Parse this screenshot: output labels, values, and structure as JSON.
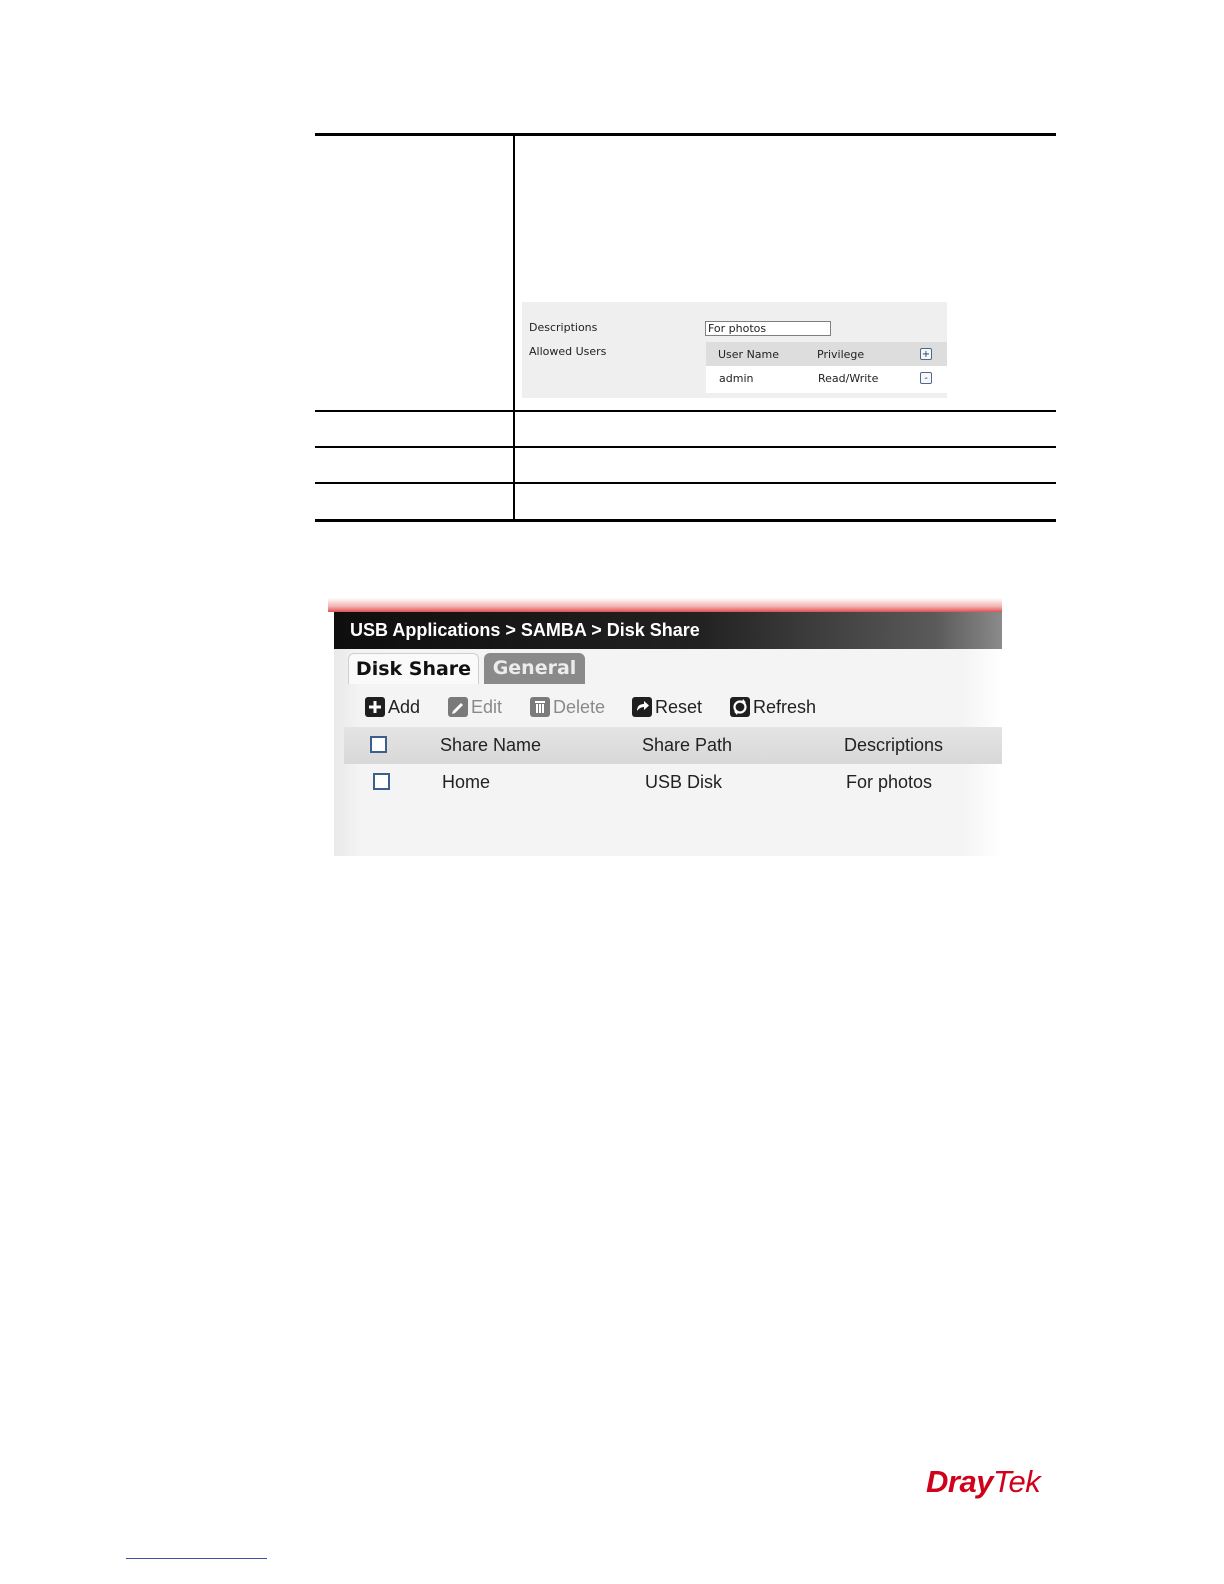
{
  "form_crop": {
    "descriptions_label": "Descriptions",
    "descriptions_value": "For photos",
    "allowed_users_label": "Allowed Users",
    "users_table": {
      "columns": [
        "User Name",
        "Privilege"
      ],
      "rows": [
        {
          "user": "admin",
          "privilege": "Read/Write"
        }
      ],
      "add_symbol": "+",
      "remove_symbol": "-"
    }
  },
  "disk_share": {
    "breadcrumb": "USB Applications > SAMBA > Disk Share",
    "tabs": [
      "Disk Share",
      "General"
    ],
    "toolbar": {
      "add": "Add",
      "edit": "Edit",
      "delete": "Delete",
      "reset": "Reset",
      "refresh": "Refresh"
    },
    "columns": [
      "Share Name",
      "Share Path",
      "Descriptions"
    ],
    "rows": [
      {
        "share_name": "Home",
        "share_path": "USB Disk",
        "descriptions": "For photos"
      }
    ],
    "colors": {
      "accent_red": "#e15050",
      "title_bg": "#1a1a1a",
      "checkbox_border": "#3c5f8c"
    }
  },
  "footer": {
    "logo_part1": "Dray",
    "logo_part2": "Tek",
    "logo_color": "#d0021b"
  }
}
